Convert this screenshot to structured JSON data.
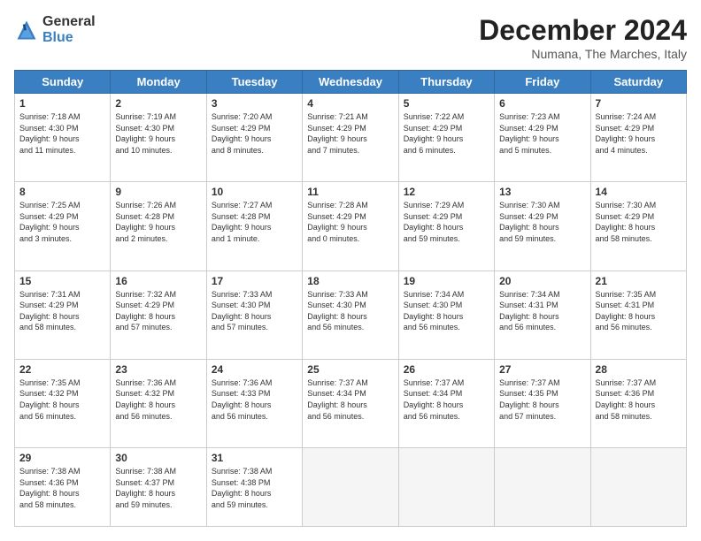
{
  "header": {
    "logo_line1": "General",
    "logo_line2": "Blue",
    "month": "December 2024",
    "location": "Numana, The Marches, Italy"
  },
  "weekdays": [
    "Sunday",
    "Monday",
    "Tuesday",
    "Wednesday",
    "Thursday",
    "Friday",
    "Saturday"
  ],
  "weeks": [
    [
      {
        "day": "1",
        "info": "Sunrise: 7:18 AM\nSunset: 4:30 PM\nDaylight: 9 hours\nand 11 minutes."
      },
      {
        "day": "2",
        "info": "Sunrise: 7:19 AM\nSunset: 4:30 PM\nDaylight: 9 hours\nand 10 minutes."
      },
      {
        "day": "3",
        "info": "Sunrise: 7:20 AM\nSunset: 4:29 PM\nDaylight: 9 hours\nand 8 minutes."
      },
      {
        "day": "4",
        "info": "Sunrise: 7:21 AM\nSunset: 4:29 PM\nDaylight: 9 hours\nand 7 minutes."
      },
      {
        "day": "5",
        "info": "Sunrise: 7:22 AM\nSunset: 4:29 PM\nDaylight: 9 hours\nand 6 minutes."
      },
      {
        "day": "6",
        "info": "Sunrise: 7:23 AM\nSunset: 4:29 PM\nDaylight: 9 hours\nand 5 minutes."
      },
      {
        "day": "7",
        "info": "Sunrise: 7:24 AM\nSunset: 4:29 PM\nDaylight: 9 hours\nand 4 minutes."
      }
    ],
    [
      {
        "day": "8",
        "info": "Sunrise: 7:25 AM\nSunset: 4:29 PM\nDaylight: 9 hours\nand 3 minutes."
      },
      {
        "day": "9",
        "info": "Sunrise: 7:26 AM\nSunset: 4:28 PM\nDaylight: 9 hours\nand 2 minutes."
      },
      {
        "day": "10",
        "info": "Sunrise: 7:27 AM\nSunset: 4:28 PM\nDaylight: 9 hours\nand 1 minute."
      },
      {
        "day": "11",
        "info": "Sunrise: 7:28 AM\nSunset: 4:29 PM\nDaylight: 9 hours\nand 0 minutes."
      },
      {
        "day": "12",
        "info": "Sunrise: 7:29 AM\nSunset: 4:29 PM\nDaylight: 8 hours\nand 59 minutes."
      },
      {
        "day": "13",
        "info": "Sunrise: 7:30 AM\nSunset: 4:29 PM\nDaylight: 8 hours\nand 59 minutes."
      },
      {
        "day": "14",
        "info": "Sunrise: 7:30 AM\nSunset: 4:29 PM\nDaylight: 8 hours\nand 58 minutes."
      }
    ],
    [
      {
        "day": "15",
        "info": "Sunrise: 7:31 AM\nSunset: 4:29 PM\nDaylight: 8 hours\nand 58 minutes."
      },
      {
        "day": "16",
        "info": "Sunrise: 7:32 AM\nSunset: 4:29 PM\nDaylight: 8 hours\nand 57 minutes."
      },
      {
        "day": "17",
        "info": "Sunrise: 7:33 AM\nSunset: 4:30 PM\nDaylight: 8 hours\nand 57 minutes."
      },
      {
        "day": "18",
        "info": "Sunrise: 7:33 AM\nSunset: 4:30 PM\nDaylight: 8 hours\nand 56 minutes."
      },
      {
        "day": "19",
        "info": "Sunrise: 7:34 AM\nSunset: 4:30 PM\nDaylight: 8 hours\nand 56 minutes."
      },
      {
        "day": "20",
        "info": "Sunrise: 7:34 AM\nSunset: 4:31 PM\nDaylight: 8 hours\nand 56 minutes."
      },
      {
        "day": "21",
        "info": "Sunrise: 7:35 AM\nSunset: 4:31 PM\nDaylight: 8 hours\nand 56 minutes."
      }
    ],
    [
      {
        "day": "22",
        "info": "Sunrise: 7:35 AM\nSunset: 4:32 PM\nDaylight: 8 hours\nand 56 minutes."
      },
      {
        "day": "23",
        "info": "Sunrise: 7:36 AM\nSunset: 4:32 PM\nDaylight: 8 hours\nand 56 minutes."
      },
      {
        "day": "24",
        "info": "Sunrise: 7:36 AM\nSunset: 4:33 PM\nDaylight: 8 hours\nand 56 minutes."
      },
      {
        "day": "25",
        "info": "Sunrise: 7:37 AM\nSunset: 4:34 PM\nDaylight: 8 hours\nand 56 minutes."
      },
      {
        "day": "26",
        "info": "Sunrise: 7:37 AM\nSunset: 4:34 PM\nDaylight: 8 hours\nand 56 minutes."
      },
      {
        "day": "27",
        "info": "Sunrise: 7:37 AM\nSunset: 4:35 PM\nDaylight: 8 hours\nand 57 minutes."
      },
      {
        "day": "28",
        "info": "Sunrise: 7:37 AM\nSunset: 4:36 PM\nDaylight: 8 hours\nand 58 minutes."
      }
    ],
    [
      {
        "day": "29",
        "info": "Sunrise: 7:38 AM\nSunset: 4:36 PM\nDaylight: 8 hours\nand 58 minutes."
      },
      {
        "day": "30",
        "info": "Sunrise: 7:38 AM\nSunset: 4:37 PM\nDaylight: 8 hours\nand 59 minutes."
      },
      {
        "day": "31",
        "info": "Sunrise: 7:38 AM\nSunset: 4:38 PM\nDaylight: 8 hours\nand 59 minutes."
      },
      null,
      null,
      null,
      null
    ]
  ]
}
